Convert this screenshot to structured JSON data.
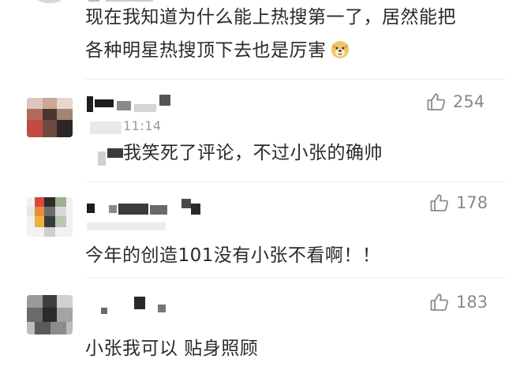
{
  "comments": [
    {
      "text_line1": "现在我知道为什么能上热搜第一了，居然能把",
      "text_line2": "各种明星热搜顶下去也是厉害",
      "emoji": "doge-emoji"
    },
    {
      "time": "11:14",
      "text": "我笑死了评论，不过小张的确帅",
      "likes": "254"
    },
    {
      "text": "今年的创造101没有小张不看啊！！",
      "likes": "178"
    },
    {
      "text": "小张我可以 贴身照顾",
      "likes": "183"
    }
  ],
  "icons": {
    "like": "thumbs-up-icon"
  },
  "colors": {
    "text": "#2a2a2a",
    "muted": "#8a8a8a",
    "divider": "#ededed",
    "background": "#ffffff"
  }
}
